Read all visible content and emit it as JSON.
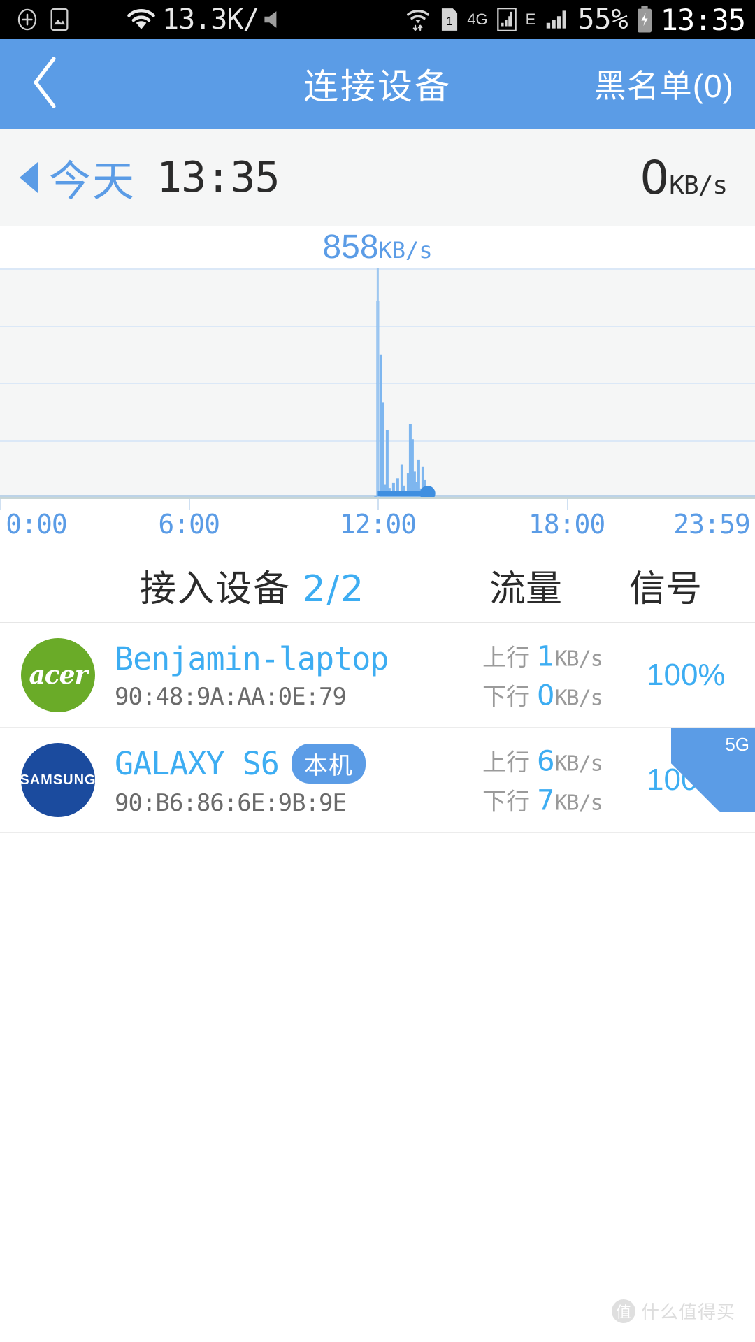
{
  "statusbar": {
    "left_icons": [
      "plus-circle-icon",
      "image-icon"
    ],
    "net_speed": "13.3K/",
    "right_icons": [
      "wifi-icon",
      "mute-icon",
      "wifi-data-icon",
      "sim1-icon",
      "signal-icon-1",
      "signal-icon-2"
    ],
    "network_4g": "4G",
    "network_e": "E",
    "battery": "55%",
    "clock": "13:35"
  },
  "appbar": {
    "back_icon": "chevron-left-icon",
    "title": "连接设备",
    "action": "黑名单(0)"
  },
  "summary": {
    "prev_icon": "triangle-left-icon",
    "day": "今天",
    "time": "13:35",
    "speed_value": "0",
    "speed_unit": "KB/s"
  },
  "chart_data": {
    "type": "bar",
    "title": "",
    "peak_label_value": "858",
    "peak_label_unit": "KB/s",
    "xlabel": "",
    "ylabel": "",
    "grid": true,
    "legend": "none",
    "xlim": [
      0,
      1439
    ],
    "ylim": [
      0,
      1000
    ],
    "xtick_labels": [
      "0:00",
      "6:00",
      "12:00",
      "18:00",
      "23:59"
    ],
    "xtick_values": [
      0,
      360,
      720,
      1080,
      1439
    ],
    "gridline_values": [
      1000,
      750,
      500,
      250
    ],
    "peak_x": 720,
    "peak_y": 858,
    "current_marker_x": 815,
    "current_marker_y": 0,
    "x": [
      716,
      720,
      726,
      730,
      734,
      738,
      742,
      746,
      750,
      754,
      758,
      762,
      766,
      770,
      774,
      778,
      782,
      786,
      790,
      794,
      798,
      802,
      806,
      810,
      814
    ],
    "values": [
      14,
      858,
      625,
      420,
      62,
      300,
      48,
      22,
      70,
      16,
      90,
      26,
      150,
      58,
      34,
      112,
      325,
      260,
      120,
      74,
      170,
      46,
      140,
      82,
      20
    ]
  },
  "table": {
    "header": {
      "devices_label": "接入设备",
      "devices_count": "2/2",
      "traffic_label": "流量",
      "signal_label": "信号"
    },
    "rows": [
      {
        "logo_name": "acer-logo",
        "logo_text": "acer",
        "logo_color": "#6aab28",
        "name": "Benjamin-laptop",
        "badge": "",
        "mac": "90:48:9A:AA:0E:79",
        "up_label": "上行",
        "up_value": "1",
        "up_unit": "KB/s",
        "down_label": "下行",
        "down_value": "0",
        "down_unit": "KB/s",
        "signal": "100%",
        "corner_tag": ""
      },
      {
        "logo_name": "samsung-logo",
        "logo_text": "SAMSUNG",
        "logo_color": "#1b4b9e",
        "name": "GALAXY S6",
        "badge": "本机",
        "mac": "90:B6:86:6E:9B:9E",
        "up_label": "上行",
        "up_value": "6",
        "up_unit": "KB/s",
        "down_label": "下行",
        "down_value": "7",
        "down_unit": "KB/s",
        "signal": "100%",
        "corner_tag": "5G"
      }
    ]
  },
  "watermark": {
    "badge": "值",
    "text": "什么值得买"
  },
  "colors": {
    "accent_blue": "#5b9ce6",
    "link_blue": "#3dadf2",
    "chart_blue": "#7eb6ef",
    "bg_gray": "#f5f6f6"
  }
}
